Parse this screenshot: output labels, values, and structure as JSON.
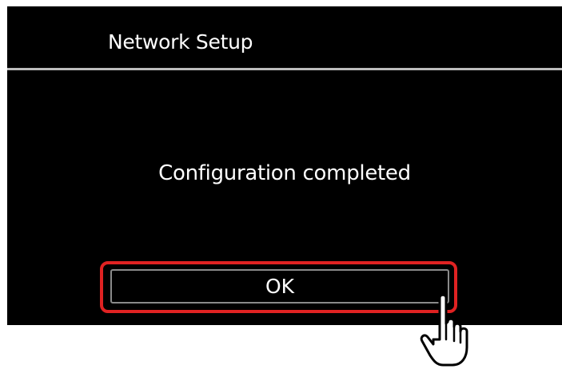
{
  "dialog": {
    "title": "Network Setup",
    "message": "Configuration completed",
    "ok_label": "OK"
  },
  "colors": {
    "screen_background": "#000000",
    "text": "#ffffff",
    "divider": "#bdbdbd",
    "highlight": "#e02222"
  },
  "icons": {
    "pointer": "tap-hand-icon"
  }
}
